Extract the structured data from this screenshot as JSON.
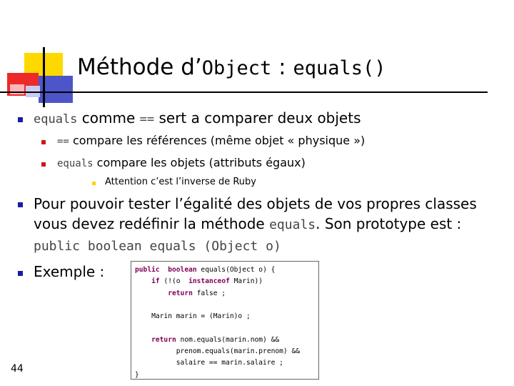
{
  "slide": {
    "title_prefix": "Méthode d’",
    "title_object": "Object",
    "title_sep": " : ",
    "title_method": "equals()",
    "page_number": "44"
  },
  "bullets": {
    "b1": {
      "code": "equals",
      "text_mid": " comme ",
      "code2": "==",
      "text_end": " sert a comparer deux objets"
    },
    "b1_1": {
      "code": "==",
      "text": " compare les références (même objet « physique »)"
    },
    "b1_2": {
      "code": "equals",
      "text": " compare les objets (attributs égaux)"
    },
    "b1_2_1": {
      "text": "Attention c’est l’inverse de Ruby"
    },
    "b2": {
      "text1": "Pour pouvoir tester l’égalité des objets de vos propres classes vous devez redéfinir la méthode ",
      "code1": "equals",
      "text2": ". Son prototype est : ",
      "code2": "public boolean equals (Object o)"
    },
    "b3": {
      "text": "Exemple :"
    }
  },
  "code": {
    "l1_kw1": "public",
    "l1_kw2": "boolean",
    "l1_rest": " equals(Object o) {",
    "l2_indent": "    ",
    "l2_kw": "if",
    "l2_mid": " (!(o  ",
    "l2_kw2": "instanceof",
    "l2_rest": " Marin))",
    "l3_indent": "        ",
    "l3_kw": "return",
    "l3_rest": " false ;",
    "l5": "    Marin marin = (Marin)o ;",
    "l7_indent": "    ",
    "l7_kw": "return",
    "l7_rest": " nom.equals(marin.nom) &&",
    "l8": "          prenom.equals(marin.prenom) &&",
    "l9": "          salaire == marin.salaire ;",
    "l10": "}"
  }
}
